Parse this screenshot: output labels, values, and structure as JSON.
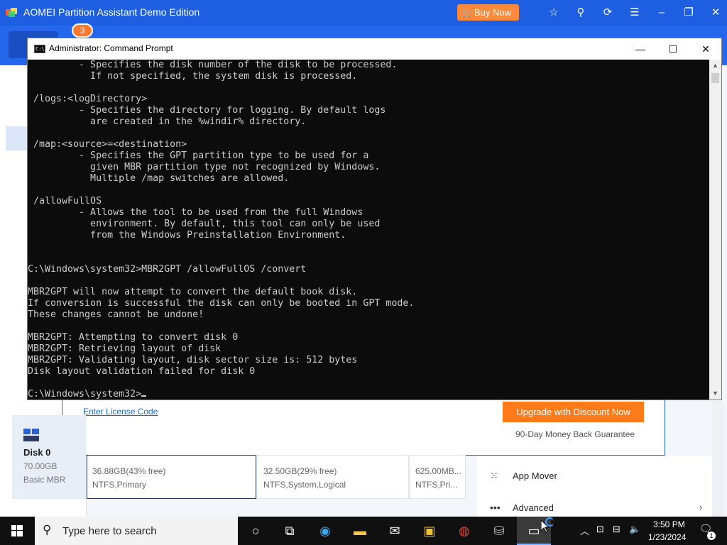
{
  "aomei": {
    "title": "AOMEI Partition Assistant Demo Edition",
    "buy_now": "Buy Now",
    "notification_badge": "3",
    "license_link": "Enter License Code",
    "upgrade_button": "Upgrade with Discount Now",
    "guarantee": "90-Day Money Back Guarantee",
    "disk": {
      "name": "Disk 0",
      "size": "70.00GB",
      "type": "Basic MBR"
    },
    "partitions": [
      {
        "line1": "36.88GB(43% free)",
        "line2": "NTFS,Primary"
      },
      {
        "line1": "32.50GB(29% free)",
        "line2": "NTFS,System,Logical"
      },
      {
        "line1": "625.00MB...",
        "line2": "NTFS,Pri..."
      }
    ],
    "menu": [
      {
        "label": "App Mover",
        "icon": "grid-dots-icon"
      },
      {
        "label": "Advanced",
        "icon": "more-dots-icon"
      }
    ]
  },
  "cmd": {
    "title": "Administrator: Command Prompt",
    "output": "         - Specifies the disk number of the disk to be processed.\n           If not specified, the system disk is processed.\n\n /logs:<logDirectory>\n         - Specifies the directory for logging. By default logs\n           are created in the %windir% directory.\n\n /map:<source>=<destination>\n         - Specifies the GPT partition type to be used for a\n           given MBR partition type not recognized by Windows.\n           Multiple /map switches are allowed.\n\n /allowFullOS\n         - Allows the tool to be used from the full Windows\n           environment. By default, this tool can only be used\n           from the Windows Preinstallation Environment.\n\n\nC:\\Windows\\system32>MBR2GPT /allowFullOS /convert\n\nMBR2GPT will now attempt to convert the default book disk.\nIf conversion is successful the disk can only be booted in GPT mode.\nThese changes cannot be undone!\n\nMBR2GPT: Attempting to convert disk 0\nMBR2GPT: Retrieving layout of disk\nMBR2GPT: Validating layout, disk sector size is: 512 bytes\nDisk layout validation failed for disk 0\n\nC:\\Windows\\system32>"
  },
  "taskbar": {
    "search_placeholder": "Type here to search",
    "time": "3:50 PM",
    "date": "1/23/2024",
    "notification_count": "1"
  },
  "colors": {
    "aomei_blue": "#1d5fe0",
    "accent_orange": "#ff7b1a",
    "console_bg": "#0c0c0c",
    "console_text": "#cccccc"
  }
}
